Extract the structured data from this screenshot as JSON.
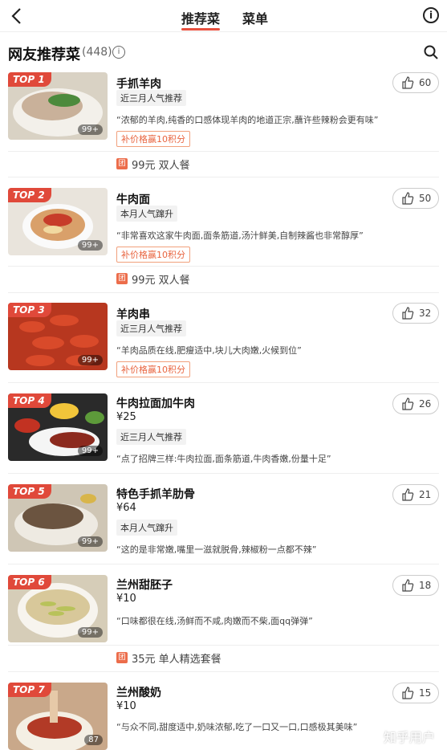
{
  "nav": {
    "tabs": [
      "推荐菜",
      "菜单"
    ],
    "active_tab": "推荐菜"
  },
  "section": {
    "title": "网友推荐菜",
    "count": "(448)"
  },
  "dishes": [
    {
      "rank": "TOP 1",
      "name": "手抓羊肉",
      "price": "",
      "tag": "近三月人气推荐",
      "quote": "“浓郁的羊肉,纯香的口感体现羊肉的地道正宗,蘸许些辣粉会更有味”",
      "promo": "补价格赢10积分",
      "likes": "60",
      "photos": "99+"
    },
    {
      "rank": "TOP 2",
      "name": "牛肉面",
      "price": "",
      "tag": "本月人气蹿升",
      "quote": "“非常喜欢这家牛肉面,面条筋道,汤汁鲜美,自制辣酱也非常醇厚”",
      "promo": "补价格赢10积分",
      "likes": "50",
      "photos": "99+"
    },
    {
      "rank": "TOP 3",
      "name": "羊肉串",
      "price": "",
      "tag": "近三月人气推荐",
      "quote": "“羊肉品质在线,肥瘦适中,块儿大肉嫩,火候到位”",
      "promo": "补价格赢10积分",
      "likes": "32",
      "photos": "99+"
    },
    {
      "rank": "TOP 4",
      "name": "牛肉拉面加牛肉",
      "price": "¥25",
      "tag": "近三月人气推荐",
      "quote": "“点了招牌三样:牛肉拉面,面条筋道,牛肉香嫩,份量十足”",
      "promo": "",
      "likes": "26",
      "photos": "99+"
    },
    {
      "rank": "TOP 5",
      "name": "特色手抓羊肋骨",
      "price": "¥64",
      "tag": "本月人气蹿升",
      "quote": "“这的是非常嫩,嘴里一滋就脱骨,辣椒粉一点都不辣”",
      "promo": "",
      "likes": "21",
      "photos": "99+"
    },
    {
      "rank": "TOP 6",
      "name": "兰州甜胚子",
      "price": "¥10",
      "tag": "",
      "quote": "“口味都很在线,汤鲜而不咸,肉嫩而不柴,面qq弹弹”",
      "promo": "",
      "likes": "18",
      "photos": "99+"
    },
    {
      "rank": "TOP 7",
      "name": "兰州酸奶",
      "price": "¥10",
      "tag": "",
      "quote": "“与众不同,甜度适中,奶味浓郁,吃了一口又一口,口感极其美味”",
      "promo": "",
      "likes": "15",
      "photos": "87"
    }
  ],
  "sets": [
    {
      "text": "99元 双人餐"
    },
    {
      "text": "99元 双人餐"
    },
    {
      "text": "35元 单人精选套餐"
    }
  ],
  "set_icon": "团",
  "watermark": "知乎用户",
  "colors": {
    "accent": "#e0493a",
    "promo": "#e8643f"
  }
}
